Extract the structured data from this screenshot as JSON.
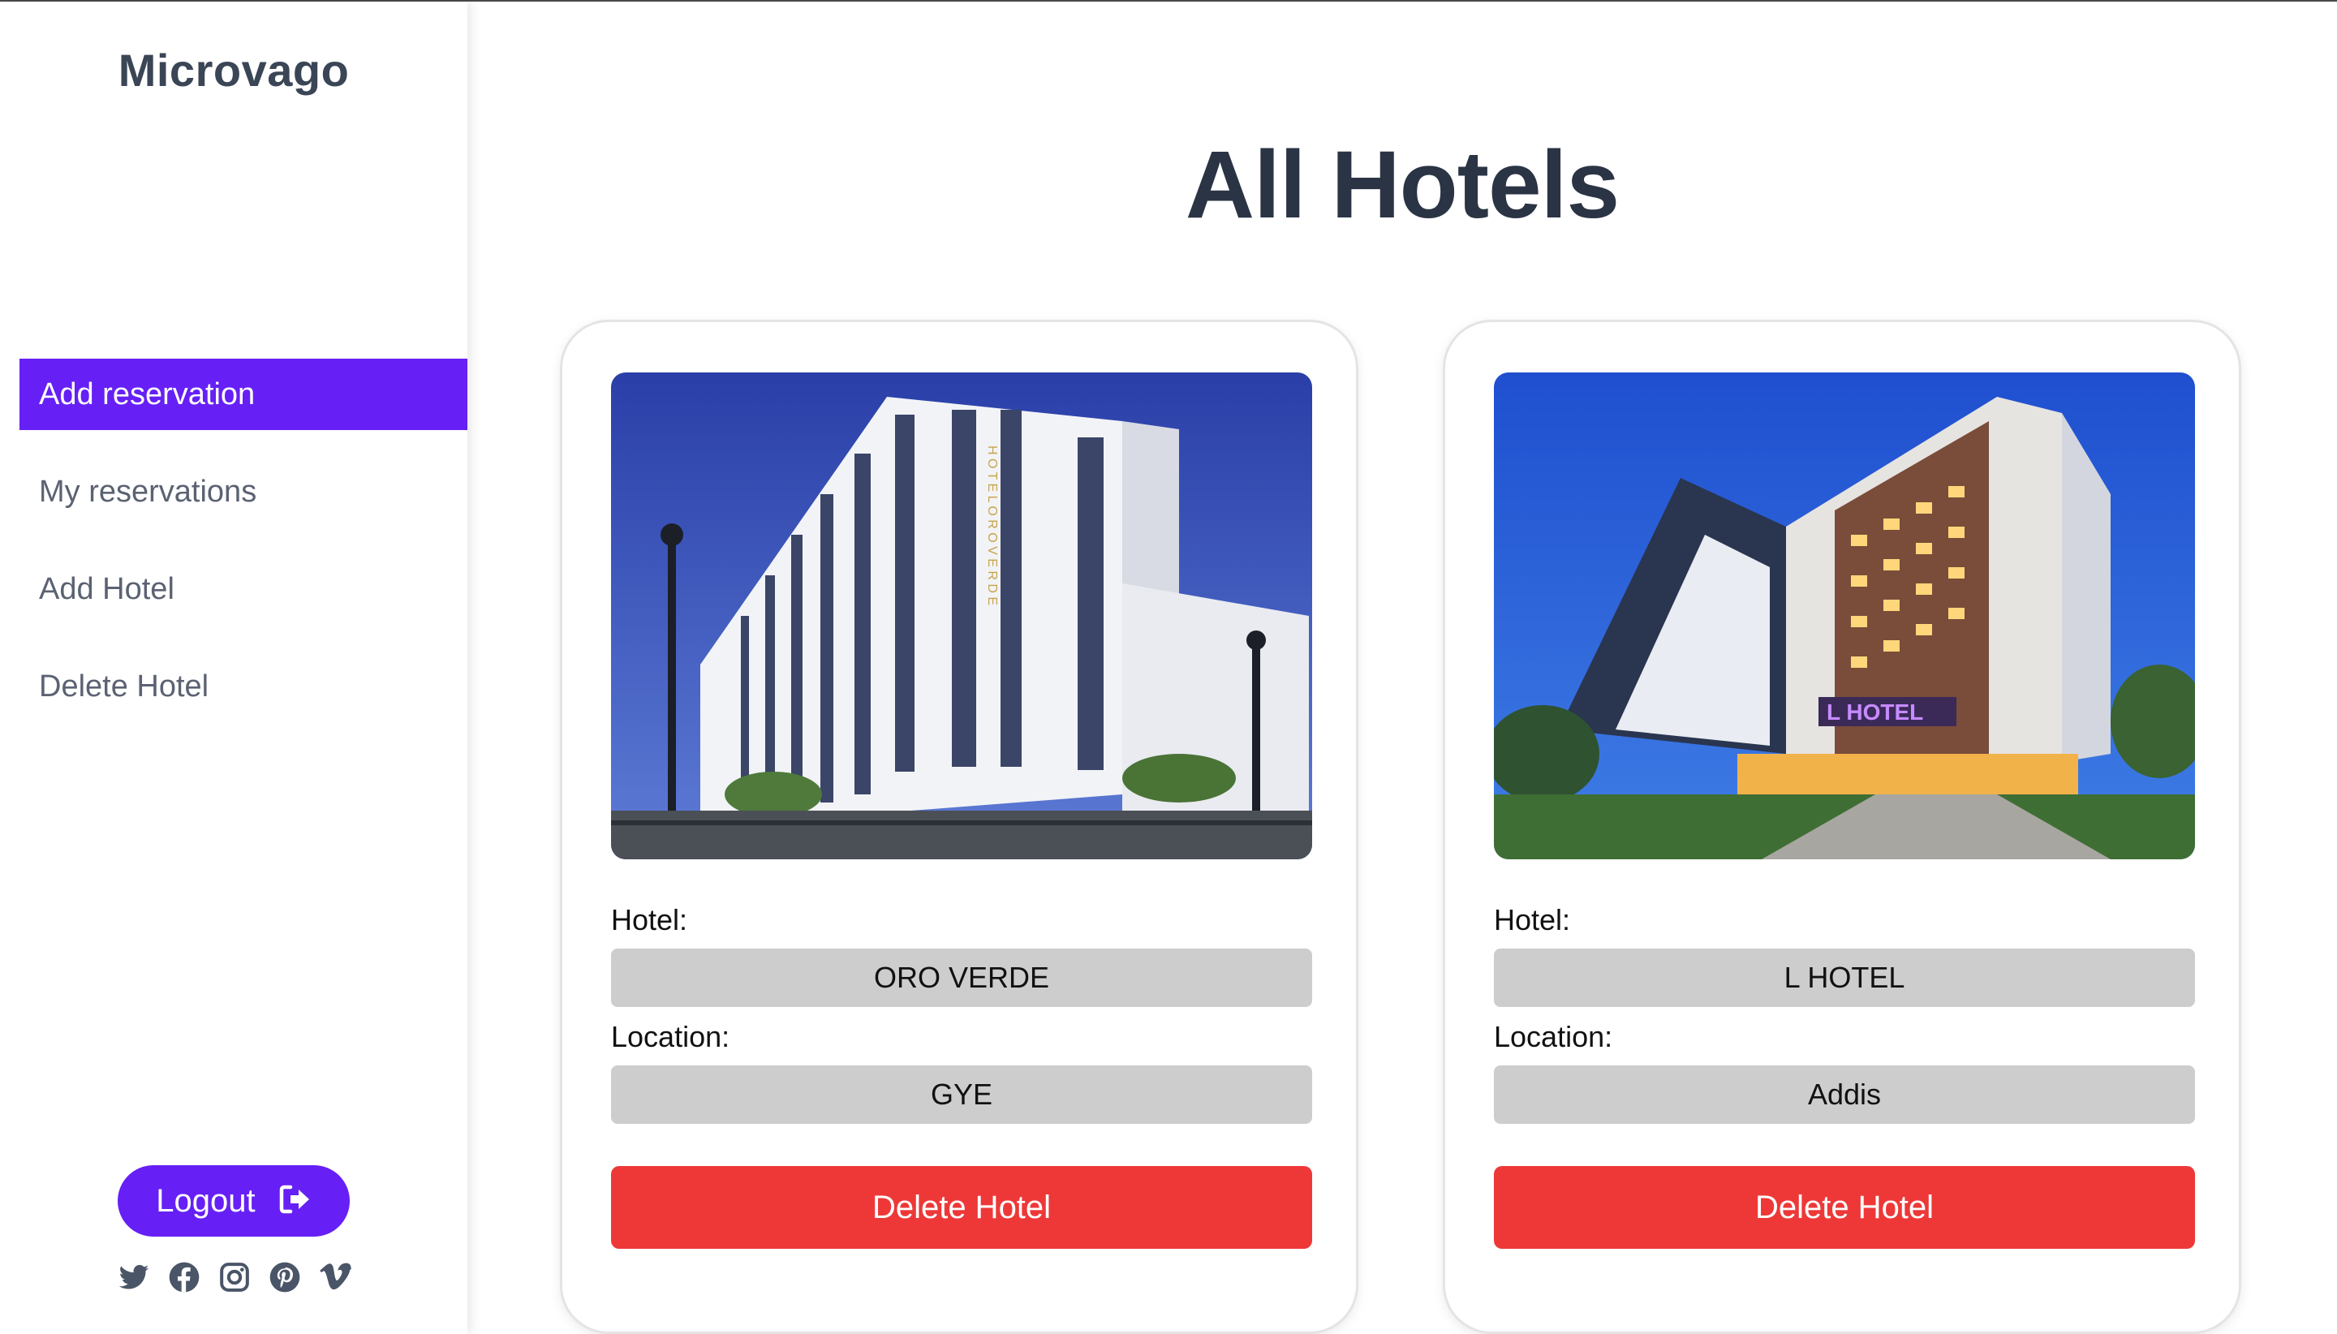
{
  "app": {
    "brand": "Microvago"
  },
  "sidebar": {
    "items": [
      {
        "label": "Add reservation",
        "active": true
      },
      {
        "label": "My reservations",
        "active": false
      },
      {
        "label": "Add Hotel",
        "active": false
      },
      {
        "label": "Delete Hotel",
        "active": false
      }
    ],
    "logout_label": "Logout",
    "logout_icon": "logout-icon",
    "socials": [
      "twitter-icon",
      "facebook-icon",
      "instagram-icon",
      "pinterest-icon",
      "vimeo-icon"
    ]
  },
  "main": {
    "title": "All Hotels",
    "hotels": [
      {
        "hotel_label": "Hotel:",
        "hotel_name": "ORO VERDE",
        "location_label": "Location:",
        "location": "GYE",
        "delete_label": "Delete Hotel",
        "image_sign": "HOTEL ORO VERDE"
      },
      {
        "hotel_label": "Hotel:",
        "hotel_name": "L HOTEL",
        "location_label": "Location:",
        "location": "Addis",
        "delete_label": "Delete Hotel",
        "image_sign": "L HOTEL"
      }
    ]
  },
  "colors": {
    "accent": "#6620f5",
    "danger": "#ee3838",
    "field_bg": "#cdcdcd",
    "text_dark": "#2b3444"
  }
}
